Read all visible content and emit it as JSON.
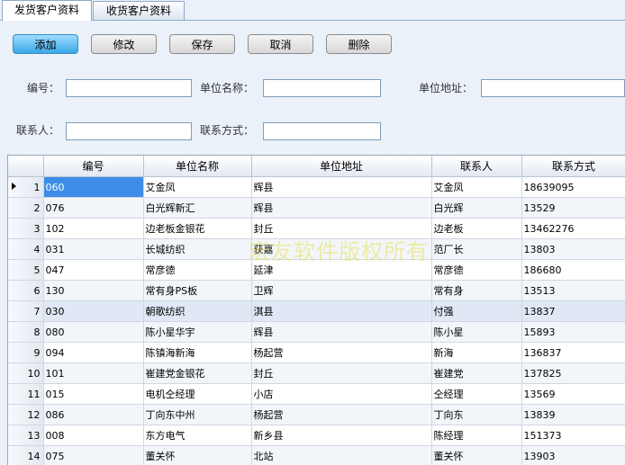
{
  "tabs": [
    {
      "label": "发货客户资料",
      "active": true
    },
    {
      "label": "收货客户资料",
      "active": false
    }
  ],
  "toolbar": {
    "add": "添加",
    "edit": "修改",
    "save": "保存",
    "cancel": "取消",
    "delete": "删除"
  },
  "form": {
    "code_label": "编号：",
    "code_value": "",
    "unit_name_label": "单位名称：",
    "unit_name_value": "",
    "address_label": "单位地址：",
    "address_value": "",
    "contact_label": "联系人：",
    "contact_value": "",
    "phone_label": "联系方式：",
    "phone_value": ""
  },
  "grid": {
    "columns": [
      "编号",
      "单位名称",
      "单位地址",
      "联系人",
      "联系方式"
    ],
    "rows": [
      {
        "n": "1",
        "code": "060",
        "name": "艾金凤",
        "address": "辉县",
        "contact": "艾金凤",
        "phone": "18639095"
      },
      {
        "n": "2",
        "code": "076",
        "name": "白光辉新汇",
        "address": "辉县",
        "contact": "白光辉",
        "phone": "13529"
      },
      {
        "n": "3",
        "code": "102",
        "name": "边老板金银花",
        "address": "封丘",
        "contact": "边老板",
        "phone": "13462276"
      },
      {
        "n": "4",
        "code": "031",
        "name": "长城纺织",
        "address": "获嘉",
        "contact": "范厂长",
        "phone": "13803"
      },
      {
        "n": "5",
        "code": "047",
        "name": "常彦德",
        "address": "延津",
        "contact": "常彦德",
        "phone": "186680"
      },
      {
        "n": "6",
        "code": "130",
        "name": "常有身PS板",
        "address": "卫辉",
        "contact": "常有身",
        "phone": "13513"
      },
      {
        "n": "7",
        "code": "030",
        "name": "朝歌纺织",
        "address": "淇县",
        "contact": "付强",
        "phone": "13837"
      },
      {
        "n": "8",
        "code": "080",
        "name": "陈小星华宇",
        "address": "辉县",
        "contact": "陈小星",
        "phone": "15893"
      },
      {
        "n": "9",
        "code": "094",
        "name": "陈镇海新海",
        "address": "杨起营",
        "contact": "新海",
        "phone": "136837"
      },
      {
        "n": "10",
        "code": "101",
        "name": "崔建党金银花",
        "address": "封丘",
        "contact": "崔建党",
        "phone": "137825"
      },
      {
        "n": "11",
        "code": "015",
        "name": "电机仝经理",
        "address": "小店",
        "contact": "仝经理",
        "phone": "13569"
      },
      {
        "n": "12",
        "code": "086",
        "name": "丁向东中州",
        "address": "杨起营",
        "contact": "丁向东",
        "phone": "13839"
      },
      {
        "n": "13",
        "code": "008",
        "name": "东方电气",
        "address": "新乡县",
        "contact": "陈经理",
        "phone": "151373"
      },
      {
        "n": "14",
        "code": "075",
        "name": "董关怀",
        "address": "北站",
        "contact": "董关怀",
        "phone": "13903"
      }
    ]
  },
  "watermark": "宏友软件版权所有"
}
